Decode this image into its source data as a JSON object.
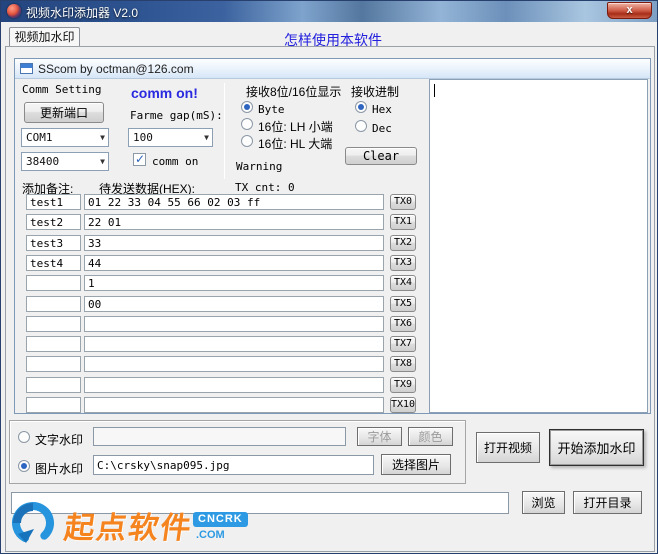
{
  "window": {
    "title": "视频水印添加器 V2.0",
    "close_label": "x"
  },
  "tabs": {
    "active_label": "视频加水印",
    "help_link": "怎样使用本软件"
  },
  "sscom": {
    "title": "SScom by octman@126.com",
    "comm_setting": {
      "group_label": "Comm Setting",
      "banner": "comm on!",
      "update_port_button": "更新端口",
      "frame_gap_label": "Farme gap(mS):",
      "port_value": "COM1",
      "frame_gap_value": "100",
      "baud_value": "38400",
      "comm_on_label": "comm on",
      "comm_on_checked": true
    },
    "display_group": {
      "label": "接收8位/16位显示",
      "options": [
        "Byte",
        "16位: LH 小端",
        "16位: HL 大端"
      ],
      "selected": "Byte",
      "selected_index": 0
    },
    "base_group": {
      "label": "接收进制",
      "options": [
        "Hex",
        "Dec"
      ],
      "selected": "Hex",
      "selected_index": 0,
      "clear_button": "Clear"
    },
    "warning_label": "Warning",
    "note_header": "添加备注:",
    "data_header": "待发送数据(HEX):",
    "tx_count": "TX cnt: 0",
    "rows": [
      {
        "note": "test1",
        "data": "01 22 33 04 55 66 02 03 ff",
        "btn": "TX0"
      },
      {
        "note": "test2",
        "data": "22 01",
        "btn": "TX1"
      },
      {
        "note": "test3",
        "data": "33",
        "btn": "TX2"
      },
      {
        "note": "test4",
        "data": "44",
        "btn": "TX3"
      },
      {
        "note": "",
        "data": "1",
        "btn": "TX4"
      },
      {
        "note": "",
        "data": "00",
        "btn": "TX5"
      },
      {
        "note": "",
        "data": "",
        "btn": "TX6"
      },
      {
        "note": "",
        "data": "",
        "btn": "TX7"
      },
      {
        "note": "",
        "data": "",
        "btn": "TX8"
      },
      {
        "note": "",
        "data": "",
        "btn": "TX9"
      },
      {
        "note": "",
        "data": "",
        "btn": "TX10"
      }
    ]
  },
  "watermark": {
    "selected_index": 1,
    "text_row": {
      "label": "文字水印",
      "value": "",
      "font_button": "字体",
      "color_button": "颜色"
    },
    "image_row": {
      "label": "图片水印",
      "value": "C:\\crsky\\snap095.jpg",
      "choose_button": "选择图片"
    }
  },
  "actions": {
    "open_video": "打开视频",
    "start_watermark": "开始添加水印",
    "browse": "浏览",
    "open_directory": "打开目录"
  },
  "output": {
    "path_value": ""
  },
  "logo": {
    "brand": "起点软件",
    "badge": "CNCRK",
    "suffix": ".COM"
  },
  "colors": {
    "titlebar_blue": "#2d5390",
    "link_blue": "#2421dd",
    "comm_on_blue": "#2a2ae0",
    "logo_orange": "#f5831e",
    "logo_blue": "#2d9ae3",
    "close_red": "#c0392b"
  }
}
